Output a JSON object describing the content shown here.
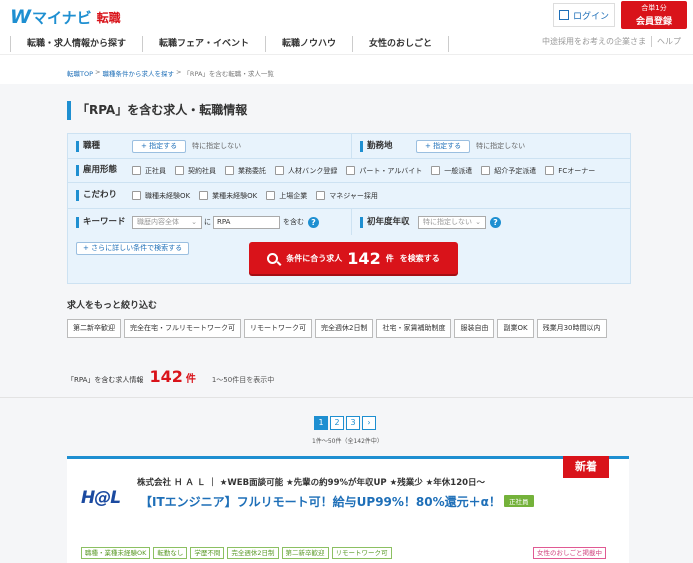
{
  "header": {
    "logo_mark": "W",
    "logo_text": "マイナビ",
    "logo_sub": "転職",
    "login_label": "ログイン",
    "register_badge": "合単1分",
    "register_label": "会員登録"
  },
  "gnav": {
    "items": [
      "転職・求人情報から探す",
      "転職フェア・イベント",
      "転職ノウハウ",
      "女性のおしごと"
    ],
    "right_links": [
      "中途採用をお考えの企業さま",
      "ヘルプ"
    ]
  },
  "breadcrumb": [
    "転職TOP",
    "職種条件から求人を探す",
    "「RPA」を含む転職・求人一覧"
  ],
  "page_title": "「RPA」を含む求人・転職情報",
  "search": {
    "shokushu_label": "職種",
    "kinmuchi_label": "勤務地",
    "add_label": "+ 指定する",
    "unspecified": "特に指定しない",
    "koyou_label": "雇用形態",
    "koyou_options": [
      "正社員",
      "契約社員",
      "業務委託",
      "人材バンク登録",
      "パート・アルバイト",
      "一般派遣",
      "紹介予定派遣",
      "FCオーナー"
    ],
    "kodawari_label": "こだわり",
    "kodawari_options": [
      "職種未経験OK",
      "業種未経験OK",
      "上場企業",
      "マネジャー採用"
    ],
    "keyword_label": "キーワード",
    "keyword_scope": "職歴内容全体",
    "keyword_ni": "に",
    "keyword_value": "RPA",
    "keyword_suffix": "を含む",
    "nenshu_label": "初年度年収",
    "nenshu_value": "特に指定しない",
    "more_conditions": "+ さらに詳しい条件で検索する",
    "button_pre": "条件に合う求人",
    "button_count": "142",
    "button_unit": "件",
    "button_post": "を検索する"
  },
  "refine": {
    "title": "求人をもっと絞り込む",
    "tags": [
      "第二新卒歓迎",
      "完全在宅・フルリモートワーク可",
      "リモートワーク可",
      "完全週休2日制",
      "社宅・家賃補助制度",
      "服装自由",
      "副業OK",
      "残業月30時間以内"
    ]
  },
  "results": {
    "prefix": "「RPA」を含む求人情報",
    "count": "142",
    "unit": "件",
    "range": "1～50件目を表示中"
  },
  "pager": {
    "pages": [
      "1",
      "2",
      "3"
    ],
    "next": "›",
    "sub": "1件～50件（全142件中）"
  },
  "job": {
    "new_badge": "新着",
    "company": "株式会社 Ｈ Ａ Ｌ ｜ ★WEB面談可能 ★先輩の約99%が年収UP ★残業少 ★年休120日～",
    "logo": "H@L",
    "title": "【ITエンジニア】フルリモート可！給与UP99%！80%還元＋α！",
    "employment": "正社員",
    "tags": [
      "職種・業種未経験OK",
      "転勤なし",
      "学歴不問",
      "完全週休2日制",
      "第二新卒歓迎",
      "リモートワーク可"
    ],
    "women_tag": "女性のおしごと掲載中"
  },
  "colors": {
    "brand_blue": "#1e8fd1",
    "brand_red": "#d9131a",
    "search_bg": "#e8f3fc"
  }
}
